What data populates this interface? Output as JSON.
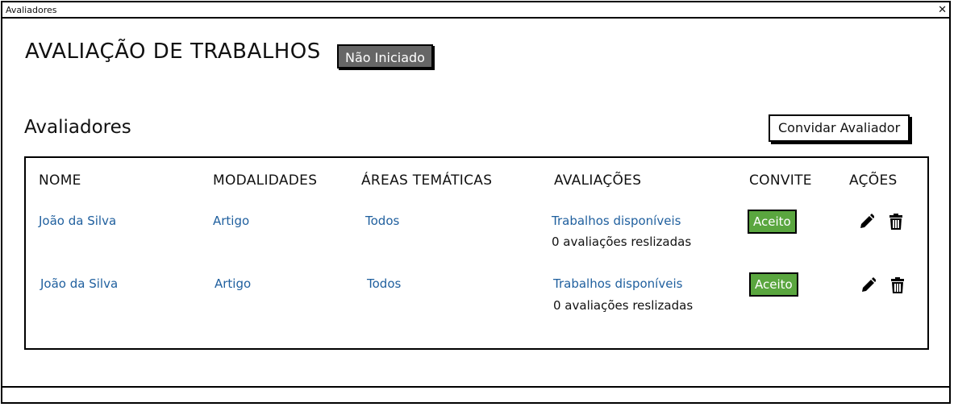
{
  "window": {
    "title": "Avaliadores",
    "close_glyph": "✕"
  },
  "header": {
    "title": "AVALIAÇÃO DE TRABALHOS",
    "status": "Não Iniciado"
  },
  "section": {
    "title": "Avaliadores",
    "invite_label": "Convidar Avaliador"
  },
  "table": {
    "columns": [
      "NOME",
      "MODALIDADES",
      "ÁREAS TEMÁTICAS",
      "AVALIAÇÕES",
      "CONVITE",
      "AÇÕES"
    ],
    "rows": [
      {
        "name": "João da Silva",
        "modality": "Artigo",
        "areas": "Todos",
        "evaluations_link": "Trabalhos disponíveis",
        "evaluations_count": "0 avaliações reslizadas",
        "invite": "Aceito",
        "actions": [
          "pencil-icon",
          "trash-icon"
        ]
      },
      {
        "name": "João da Silva",
        "modality": "Artigo",
        "areas": "Todos",
        "evaluations_link": "Trabalhos disponíveis",
        "evaluations_count": "0 avaliações reslizadas",
        "invite": "Aceito",
        "actions": [
          "pencil-icon",
          "trash-icon"
        ]
      }
    ]
  },
  "colors": {
    "link": "#1f5f9e",
    "status_badge": "#666666",
    "accept_badge": "#5aa63f"
  }
}
